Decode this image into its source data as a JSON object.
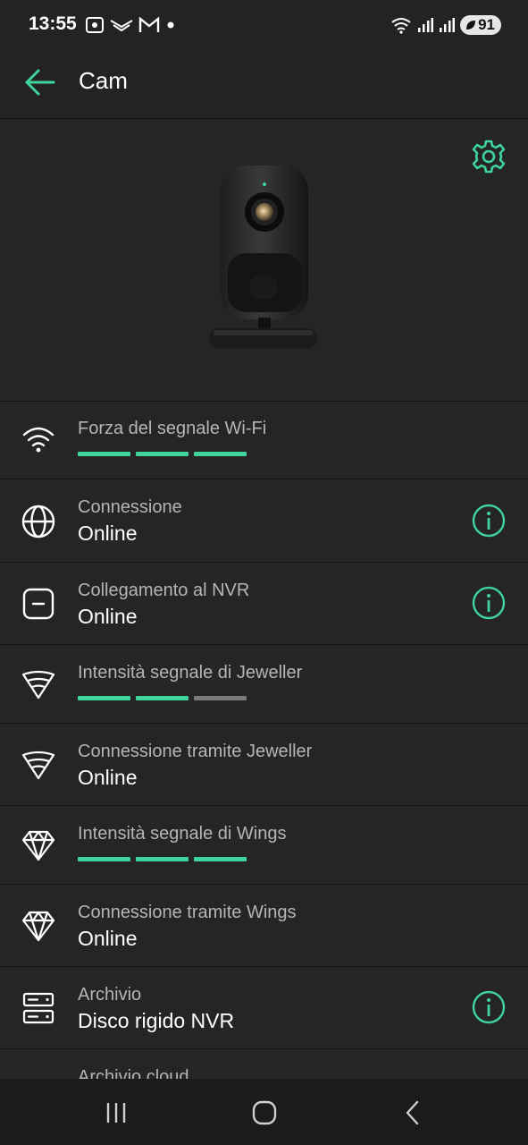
{
  "status_bar": {
    "time": "13:55",
    "battery": "91",
    "left_icons": [
      "screenshot-icon",
      "wings-icon",
      "gmail-icon",
      "dot-icon"
    ],
    "right_icons": [
      "wifi-icon",
      "signal-icon",
      "signal-icon"
    ]
  },
  "header": {
    "title": "Cam",
    "back_icon": "arrow-left-icon",
    "settings_icon": "gear-icon"
  },
  "colors": {
    "accent": "#3fd49b",
    "background": "#232323",
    "bar_inactive": "#7a7a7a"
  },
  "rows": [
    {
      "label": "Forza del segnale Wi-Fi",
      "icon": "wifi-icon",
      "signal_level": 3,
      "signal_max": 3
    },
    {
      "label": "Connessione",
      "value": "Online",
      "icon": "globe-icon",
      "info": true
    },
    {
      "label": "Collegamento al NVR",
      "value": "Online",
      "icon": "nvr-icon",
      "info": true
    },
    {
      "label": "Intensità segnale di Jeweller",
      "icon": "jeweller-icon",
      "signal_level": 2,
      "signal_max": 3
    },
    {
      "label": "Connessione tramite Jeweller",
      "value": "Online",
      "icon": "jeweller-icon"
    },
    {
      "label": "Intensità segnale di Wings",
      "icon": "wings-icon",
      "signal_level": 3,
      "signal_max": 3
    },
    {
      "label": "Connessione tramite Wings",
      "value": "Online",
      "icon": "wings-icon"
    },
    {
      "label": "Archivio",
      "value": "Disco rigido NVR",
      "icon": "storage-icon",
      "info": true
    },
    {
      "label": "Archivio cloud"
    }
  ],
  "nav": [
    "recents-icon",
    "home-icon",
    "back-icon"
  ]
}
